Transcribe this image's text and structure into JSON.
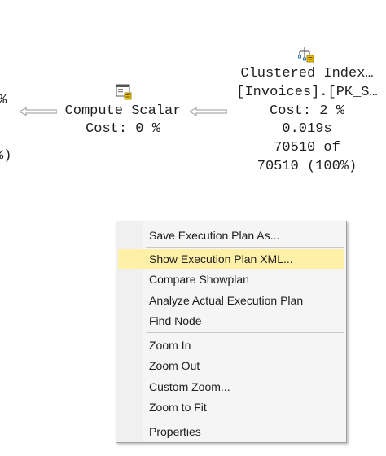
{
  "plan": {
    "left_partial": {
      "line1": "%",
      "line2": "%)"
    },
    "compute_scalar": {
      "icon": "compute-scalar-icon",
      "name": "Compute Scalar",
      "cost": "Cost: 0 %"
    },
    "clustered_index": {
      "icon": "clustered-index-scan-icon",
      "name": "Clustered Index…",
      "object": "[Invoices].[PK_S…",
      "cost": "Cost: 2 %",
      "time": "0.019s",
      "rows_line1": "70510 of",
      "rows_line2": "70510 (100%)"
    },
    "arrow_icon": "data-flow-arrow-icon"
  },
  "context_menu": {
    "items": [
      {
        "label": "Save Execution Plan As...",
        "highlighted": false
      },
      {
        "label": "Show Execution Plan XML...",
        "highlighted": true
      },
      {
        "label": "Compare Showplan",
        "highlighted": false
      },
      {
        "label": "Analyze Actual Execution Plan",
        "highlighted": false
      },
      {
        "label": "Find Node",
        "highlighted": false
      },
      {
        "label": "Zoom In",
        "highlighted": false
      },
      {
        "label": "Zoom Out",
        "highlighted": false
      },
      {
        "label": "Custom Zoom...",
        "highlighted": false
      },
      {
        "label": "Zoom to Fit",
        "highlighted": false
      },
      {
        "label": "Properties",
        "highlighted": false
      }
    ],
    "highlight_color": "#fff0a8"
  }
}
